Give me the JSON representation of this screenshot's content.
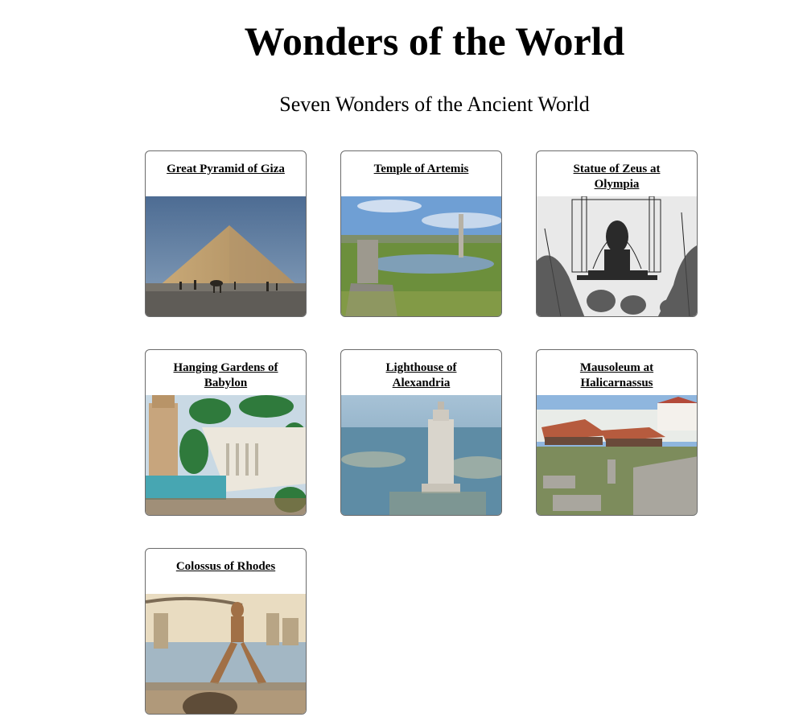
{
  "page": {
    "title": "Wonders of the World",
    "subtitle": "Seven Wonders of the Ancient World"
  },
  "wonders": [
    {
      "name": "Great Pyramid of Giza",
      "image": "pyramid-photo"
    },
    {
      "name": "Temple of Artemis",
      "image": "temple-ruins-photo"
    },
    {
      "name": "Statue of Zeus at Olympia",
      "image": "zeus-engraving"
    },
    {
      "name": "Hanging Gardens of Babylon",
      "image": "gardens-painting"
    },
    {
      "name": "Lighthouse of Alexandria",
      "image": "lighthouse-render"
    },
    {
      "name": "Mausoleum at Halicarnassus",
      "image": "mausoleum-ruins-photo"
    },
    {
      "name": "Colossus of Rhodes",
      "image": "colossus-engraving"
    }
  ]
}
